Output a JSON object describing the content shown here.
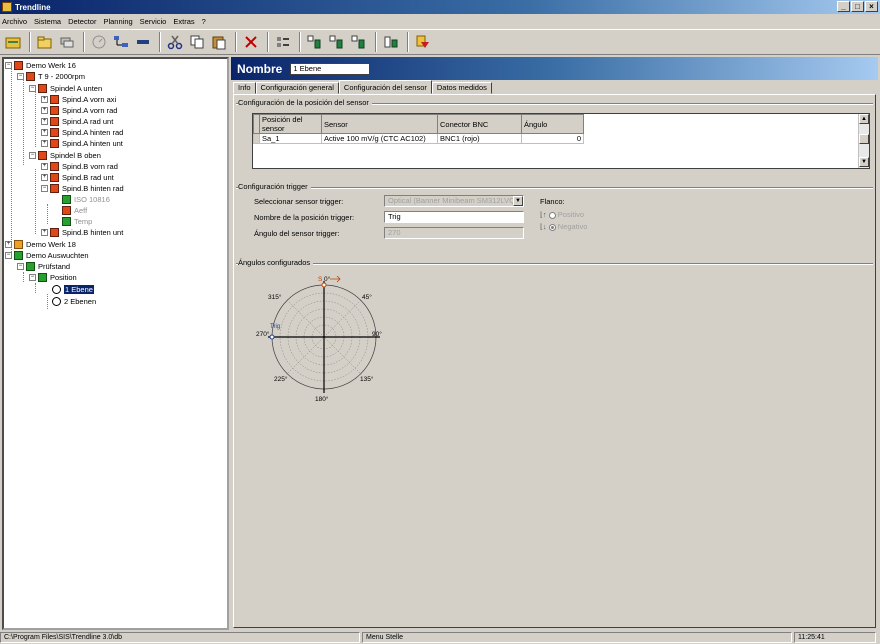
{
  "window": {
    "title": "Trendline",
    "controls": [
      "_",
      "□",
      "×"
    ]
  },
  "menu": [
    "Archivo",
    "Sistema",
    "Detector",
    "Planning",
    "Servicio",
    "Extras",
    "?"
  ],
  "toolbar_icons": [
    "open-folder-icon",
    "new-folder-icon",
    "stack-icon",
    "gauge-icon",
    "network-icon",
    "cut-icon",
    "copy-icon",
    "paste-icon",
    "delete-icon",
    "properties-icon",
    "add-sensor-icon",
    "move-sensor-icon",
    "sort-sensor-icon",
    "config-icon",
    "wizard-icon"
  ],
  "tree": {
    "nodes": [
      {
        "label": "Demo Werk 16",
        "color": "red"
      },
      {
        "label": "T 9 - 2000rpm",
        "color": "red"
      },
      {
        "label": "Spindel A unten",
        "color": "red"
      },
      {
        "label": "Spind.A vorn axi",
        "color": "red"
      },
      {
        "label": "Spind.A vorn rad",
        "color": "red"
      },
      {
        "label": "Spind.A rad unt",
        "color": "red"
      },
      {
        "label": "Spind.A hinten rad",
        "color": "red"
      },
      {
        "label": "Spind.A hinten unt",
        "color": "red"
      },
      {
        "label": "Spindel B oben",
        "color": "red"
      },
      {
        "label": "Spind.B vorn rad",
        "color": "red"
      },
      {
        "label": "Spind.B rad unt",
        "color": "red"
      },
      {
        "label": "Spind.B hinten rad",
        "color": "red"
      },
      {
        "label": "ISO 10816",
        "color": "green"
      },
      {
        "label": "Aeff",
        "color": "red"
      },
      {
        "label": "Temp",
        "color": "green"
      },
      {
        "label": "Spind.B hinten unt",
        "color": "red"
      },
      {
        "label": "Demo Werk 18",
        "color": "orange"
      },
      {
        "label": "Demo Auswuchten",
        "color": "green"
      },
      {
        "label": "Prüfstand",
        "color": "green"
      },
      {
        "label": "Position",
        "color": "green"
      },
      {
        "label": "1 Ebene",
        "color": "clock"
      },
      {
        "label": "2 Ebenen",
        "color": "clock"
      }
    ]
  },
  "header": {
    "label": "Nombre",
    "value": "1 Ebene"
  },
  "tabs": [
    "Info",
    "Configuración general",
    "Configuración del sensor",
    "Datos medidos"
  ],
  "active_tab": "Configuración del sensor",
  "sensor_group": {
    "title": "Configuración de la posición del sensor",
    "columns": [
      "Posición del sensor",
      "Sensor",
      "Conector BNC",
      "Ángulo"
    ],
    "rows": [
      [
        "Sa_1",
        "Active 100 mV/g (CTC AC102)",
        "BNC1 (rojo)",
        "0"
      ]
    ]
  },
  "trigger_group": {
    "title": "Configuración trigger",
    "select_label": "Seleccionar sensor trigger:",
    "select_value": "Optical (Banner Minibeam SM312LVQD)",
    "name_label": "Nombre de la posición trigger:",
    "name_value": "Trig",
    "angle_label": "Ángulo del sensor trigger:",
    "angle_value": "270",
    "flank_label": "Flanco:",
    "flank_positive": "Positivo",
    "flank_negative": "Negativo"
  },
  "angles_group": {
    "title": "Ángulos configurados",
    "labels": [
      "0°",
      "45°",
      "90°",
      "135°",
      "180°",
      "225°",
      "270°",
      "315°"
    ],
    "sensor_marker": "S",
    "trigger_marker": "Trig"
  },
  "status": {
    "path": "C:\\Program Files\\SIS\\Trendline 3.0\\db",
    "mode": "Menu Stelle",
    "time": "11:25:41"
  }
}
